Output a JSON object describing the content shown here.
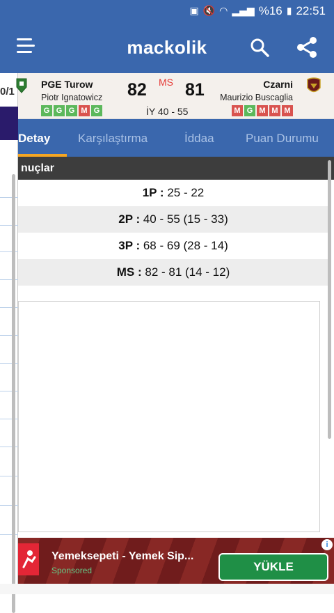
{
  "status_bar": {
    "battery_text": "%16",
    "time": "22:51"
  },
  "app_bar": {
    "logo": "mackolik",
    "icons": [
      "menu-icon",
      "search-icon",
      "share-icon"
    ]
  },
  "drawer": {
    "partial_text": "0/1"
  },
  "match": {
    "status": "MS",
    "half_time": "İY 40 - 55",
    "home": {
      "name": "PGE Turow",
      "coach": "Piotr Ignatowicz",
      "score": "82",
      "form": [
        "G",
        "G",
        "G",
        "M",
        "G"
      ]
    },
    "away": {
      "name": "Czarni",
      "coach": "Maurizio Buscaglia",
      "score": "81",
      "form": [
        "M",
        "G",
        "M",
        "M",
        "M"
      ]
    }
  },
  "tabs": {
    "detay": "Detay",
    "karsilastirma": "Karşılaştırma",
    "iddaa": "İddaa",
    "puan": "Puan Durumu",
    "active": "Detay"
  },
  "results": {
    "header": "nuçlar",
    "rows": [
      {
        "label": "1P :",
        "value": "25 - 22"
      },
      {
        "label": "2P :",
        "value": "40 - 55 (15 - 33)"
      },
      {
        "label": "3P :",
        "value": "68 - 69 (28 - 14)"
      },
      {
        "label": "MS :",
        "value": "82 - 81 (14 - 12)"
      }
    ]
  },
  "ad": {
    "title": "Yemeksepeti - Yemek Sip...",
    "sponsored": "Sponsored",
    "button": "YÜKLE",
    "info": "i"
  },
  "colors": {
    "primary": "#3a67ad",
    "tab_indicator": "#f5a623",
    "win": "#5cb85c",
    "loss": "#d9534f",
    "live_status": "#e53935",
    "ad_button": "#1f8f46"
  }
}
